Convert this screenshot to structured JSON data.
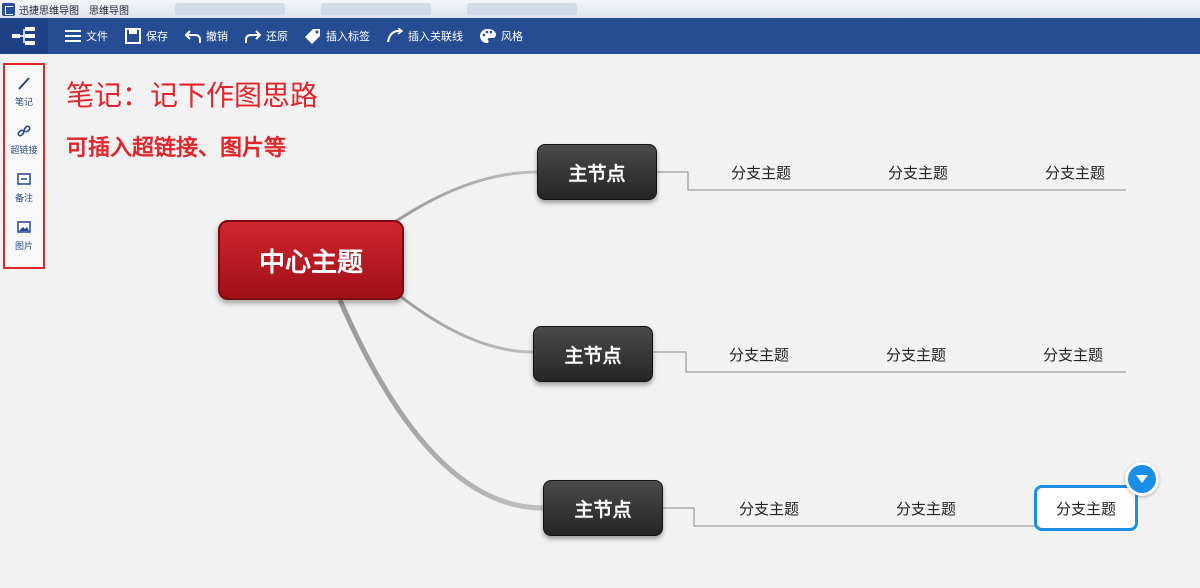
{
  "window": {
    "title": "迅捷思维导图",
    "subtitle": "思维导图"
  },
  "toolbar": {
    "items": [
      {
        "label": "文件",
        "icon": "menu-icon"
      },
      {
        "label": "保存",
        "icon": "save-icon"
      },
      {
        "label": "撤销",
        "icon": "undo-icon"
      },
      {
        "label": "还原",
        "icon": "redo-icon"
      },
      {
        "label": "插入标签",
        "icon": "tag-icon"
      },
      {
        "label": "插入关联线",
        "icon": "link-line-icon"
      },
      {
        "label": "风格",
        "icon": "palette-icon"
      }
    ]
  },
  "sidebar": {
    "items": [
      {
        "label": "笔记",
        "icon": "pencil-icon"
      },
      {
        "label": "超链接",
        "icon": "hyperlink-icon"
      },
      {
        "label": "备注",
        "icon": "note-icon"
      },
      {
        "label": "图片",
        "icon": "image-icon"
      }
    ]
  },
  "annotation": {
    "title": "笔记：记下作图思路",
    "subtitle": "可插入超链接、图片等"
  },
  "mindmap": {
    "center": "中心主题",
    "nodes": [
      {
        "label": "主节点",
        "branches": [
          "分支主题",
          "分支主题",
          "分支主题"
        ]
      },
      {
        "label": "主节点",
        "branches": [
          "分支主题",
          "分支主题",
          "分支主题"
        ]
      },
      {
        "label": "主节点",
        "branches": [
          "分支主题",
          "分支主题",
          "分支主题"
        ]
      }
    ]
  },
  "colors": {
    "toolbar": "#244d94",
    "center_node": "#c01c24",
    "main_node": "#333333",
    "annotation": "#e1252a",
    "selection": "#1b8ee8"
  }
}
